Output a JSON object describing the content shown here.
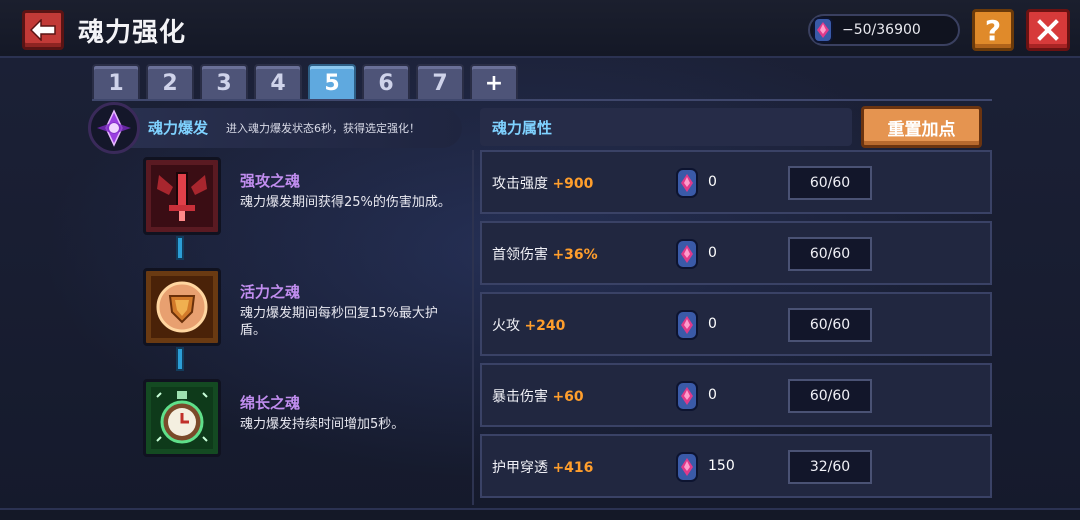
{
  "header": {
    "title": "魂力强化",
    "currency": "−50/36900",
    "help_label": "?"
  },
  "tabs": [
    "1",
    "2",
    "3",
    "4",
    "5",
    "6",
    "7",
    "+"
  ],
  "active_tab": "5",
  "skill": {
    "name": "魂力爆发",
    "desc": "进入魂力爆发状态6秒，获得选定强化！"
  },
  "souls": [
    {
      "title": "强攻之魂",
      "desc": "魂力爆发期间获得25%的伤害加成。",
      "icon": "red-sword-icon"
    },
    {
      "title": "活力之魂",
      "desc": "魂力爆发期间每秒回复15%最大护盾。",
      "icon": "shield-icon"
    },
    {
      "title": "绵长之魂",
      "desc": "魂力爆发持续时间增加5秒。",
      "icon": "clock-icon"
    }
  ],
  "attributes": {
    "title": "魂力属性",
    "reset_label": "重置加点",
    "rows": [
      {
        "name": "攻击强度",
        "bonus": "+900",
        "cost": "0",
        "progress": "60/60"
      },
      {
        "name": "首领伤害",
        "bonus": "+36%",
        "cost": "0",
        "progress": "60/60"
      },
      {
        "name": "火攻",
        "bonus": "+240",
        "cost": "0",
        "progress": "60/60"
      },
      {
        "name": "暴击伤害",
        "bonus": "+60",
        "cost": "0",
        "progress": "60/60"
      },
      {
        "name": "护甲穿透",
        "bonus": "+416",
        "cost": "150",
        "progress": "32/60"
      }
    ]
  },
  "colors": {
    "accent_blue": "#7fd2ff",
    "bonus_orange": "#ff9e2c",
    "soul_title_purple": "#c28ef0",
    "tab_active": "#5fa9df"
  }
}
